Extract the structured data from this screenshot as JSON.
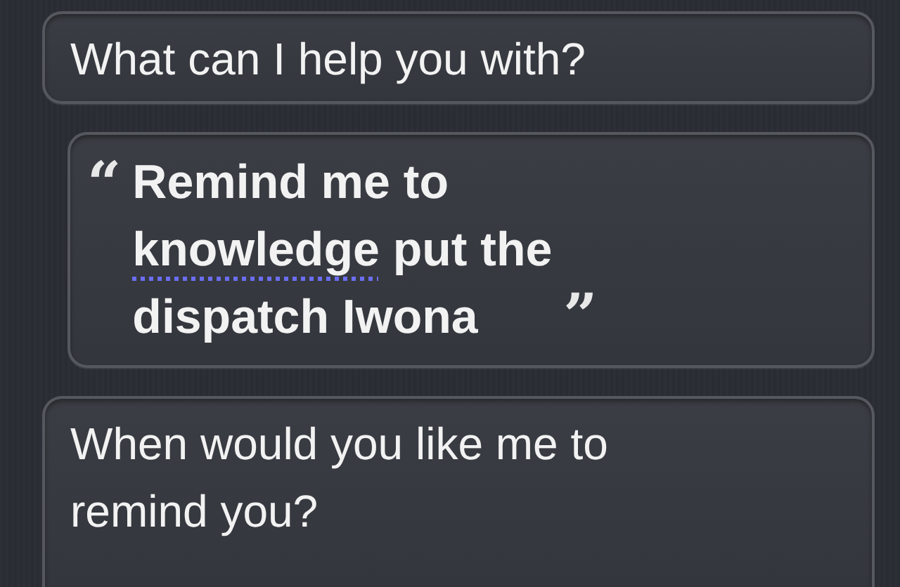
{
  "bubbles": [
    {
      "kind": "assistant",
      "lines": [
        "What can I help you with?"
      ]
    },
    {
      "kind": "user",
      "open_quote": "“",
      "close_quote": "”",
      "lines": [
        [
          {
            "text": "Remind me to",
            "underlined": false
          }
        ],
        [
          {
            "text": "knowledge",
            "underlined": true
          },
          {
            "text": " put the",
            "underlined": false
          }
        ],
        [
          {
            "text": "dispatch Iwona",
            "underlined": false
          }
        ]
      ]
    },
    {
      "kind": "assistant",
      "lines": [
        "When would you like me to",
        "remind you?"
      ]
    }
  ]
}
